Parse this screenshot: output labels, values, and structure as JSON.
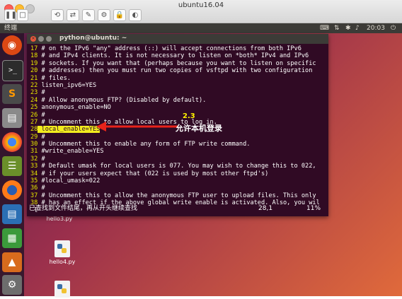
{
  "vm": {
    "title": "ubuntu16.04",
    "toolbar": [
      "⟲",
      "⇄",
      "✎",
      "⚙",
      "🔒",
      "◐"
    ]
  },
  "panel": {
    "app_name": "终端",
    "clock": "20:03",
    "tray_icons": [
      "keyboard-icon",
      "network-icon",
      "bluetooth-icon",
      "volume-icon",
      "power-icon"
    ]
  },
  "launcher": {
    "items": [
      "ubuntu-logo-icon",
      "terminal-icon",
      "sublime-icon",
      "files-icon",
      "chrome-icon",
      "books-icon",
      "firefox-icon",
      "writer-icon",
      "calc-icon",
      "impress-icon"
    ]
  },
  "desktop": {
    "files": [
      "hello3.py",
      "hello4.py"
    ]
  },
  "terminal": {
    "title": "python@ubuntu: ~",
    "lines": [
      {
        "n": "17",
        "t": " # on the IPv6 \"any\" address (::) will accept connections from both IPv6"
      },
      {
        "n": "18",
        "t": " # and IPv4 clients. It is not necessary to listen on *both* IPv4 and IPv6"
      },
      {
        "n": "19",
        "t": " # sockets. If you want that (perhaps because you want to listen on specific"
      },
      {
        "n": "20",
        "t": " # addresses) then you must run two copies of vsftpd with two configuration"
      },
      {
        "n": "21",
        "t": " # files."
      },
      {
        "n": "22",
        "t": " listen_ipv6=YES"
      },
      {
        "n": "23",
        "t": " #"
      },
      {
        "n": "24",
        "t": " # Allow anonymous FTP? (Disabled by default)."
      },
      {
        "n": "25",
        "t": " anonymous_enable=NO"
      },
      {
        "n": "26",
        "t": " #"
      },
      {
        "n": "27",
        "t": " # Uncomment this to allow local users to log in."
      },
      {
        "n": "28",
        "t": " local_enable=YES"
      },
      {
        "n": "29",
        "t": " #"
      },
      {
        "n": "30",
        "t": " # Uncomment this to enable any form of FTP write command."
      },
      {
        "n": "31",
        "t": " #write_enable=YES"
      },
      {
        "n": "32",
        "t": " #"
      },
      {
        "n": "33",
        "t": " # Default umask for local users is 077. You may wish to change this to 022,"
      },
      {
        "n": "34",
        "t": " # if your users expect that (022 is used by most other ftpd's)"
      },
      {
        "n": "35",
        "t": " #local_umask=022"
      },
      {
        "n": "36",
        "t": " #"
      },
      {
        "n": "37",
        "t": " # Uncomment this to allow the anonymous FTP user to upload files. This only"
      },
      {
        "n": "38",
        "t": " # has an effect if the above global write enable is activated. Also, you wil"
      },
      {
        "n": "",
        "t": " l"
      }
    ],
    "status_message": "已查找到文件结尾，再从开头继续查找",
    "cursor_pos": "28,1",
    "percent": "11%"
  },
  "annotation": {
    "step": "2.3",
    "text": "允许本机登录"
  },
  "colors": {
    "terminal_bg": "#300a24",
    "line_number": "#e6e600",
    "highlight": "#f2ec1e",
    "annotation_arrow": "#e8231a"
  }
}
